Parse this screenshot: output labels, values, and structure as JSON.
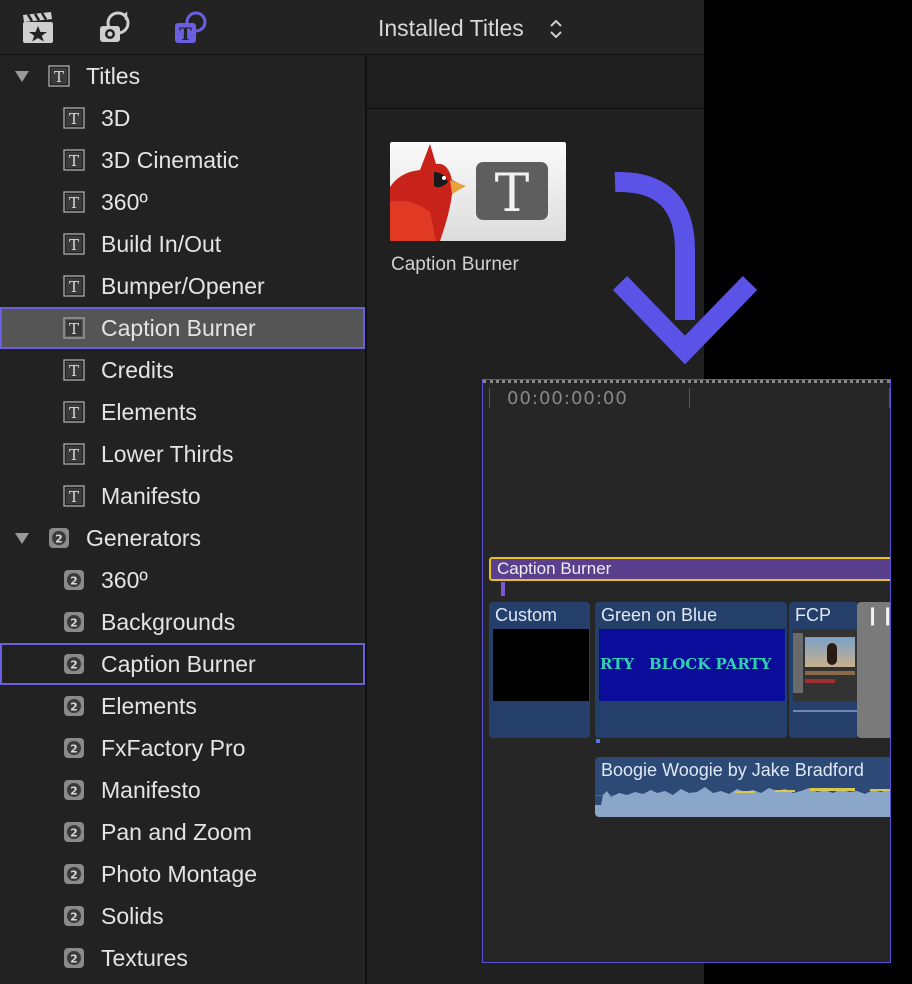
{
  "toolbar": {
    "title": "Installed Titles",
    "icons": [
      "clapper-star-icon",
      "music-camera-icon",
      "titles-generators-icon"
    ],
    "accent": "#6a5fe0"
  },
  "sidebar": {
    "groups": [
      {
        "label": "Titles",
        "icon": "title-t-icon",
        "items": [
          "3D",
          "3D Cinematic",
          "360º",
          "Build In/Out",
          "Bumper/Opener",
          "Caption Burner",
          "Credits",
          "Elements",
          "Lower Thirds",
          "Manifesto"
        ]
      },
      {
        "label": "Generators",
        "icon": "generator-icon",
        "items": [
          "360º",
          "Backgrounds",
          "Caption Burner",
          "Elements",
          "FxFactory Pro",
          "Manifesto",
          "Pan and Zoom",
          "Photo Montage",
          "Solids",
          "Textures"
        ]
      }
    ]
  },
  "browser": {
    "thumbnail_label": "Caption Burner"
  },
  "timeline": {
    "timecode": "00:00:00:00",
    "title_clip": "Caption Burner",
    "video_clips": [
      "Custom",
      "Green on Blue",
      "FCP"
    ],
    "inner_text": "BLOCK PARTY",
    "inner_text_partial": "RTY",
    "audio_clip": "Boogie Woogie by Jake Bradford",
    "colors": {
      "title_clip": "#5a3f8e",
      "title_border": "#e8c020",
      "video_clip": "#24406a",
      "audio_wave": "#8aa6c8"
    }
  }
}
